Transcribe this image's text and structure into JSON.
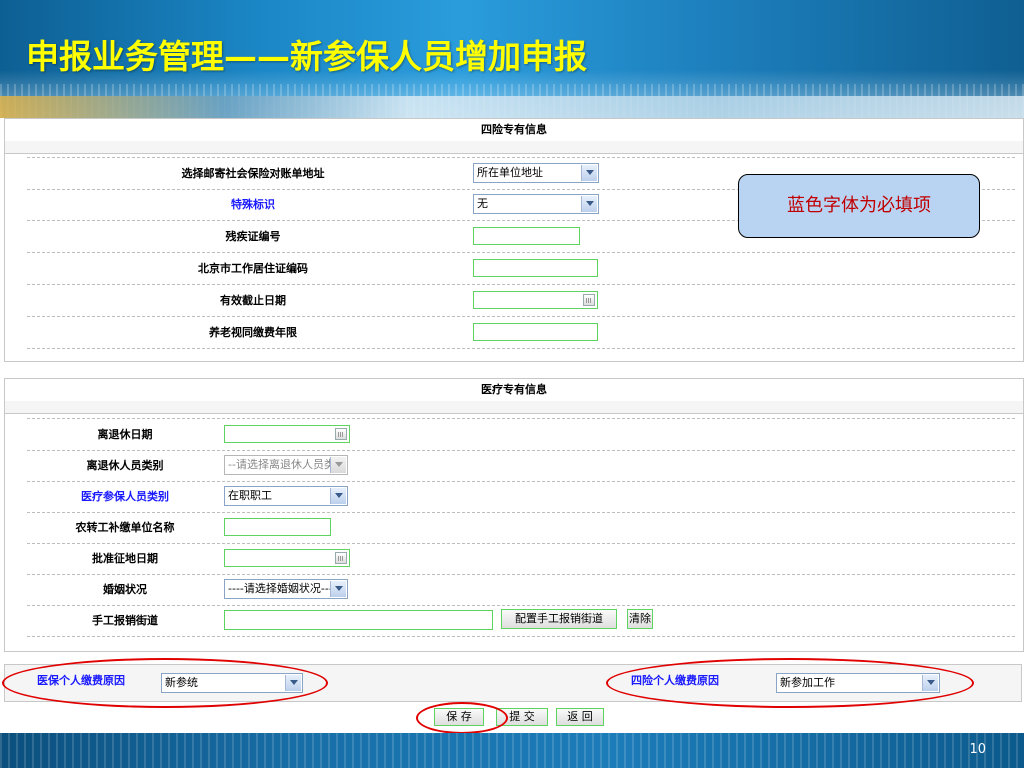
{
  "slide": {
    "title": "申报业务管理——新参保人员增加申报",
    "page_number": "10"
  },
  "note": "蓝色字体为必填项",
  "four_insurance": {
    "title": "四险专有信息",
    "rows": [
      {
        "label": "选择邮寄社会保险对账单地址",
        "value": "所在单位地址"
      },
      {
        "label": "特殊标识",
        "value": "无"
      },
      {
        "label": "残疾证编号",
        "value": ""
      },
      {
        "label": "北京市工作居住证编码",
        "value": ""
      },
      {
        "label": "有效截止日期",
        "value": ""
      },
      {
        "label": "养老视同缴费年限",
        "value": ""
      }
    ]
  },
  "medical": {
    "title": "医疗专有信息",
    "rows": [
      {
        "label": "离退休日期",
        "value": ""
      },
      {
        "label": "离退休人员类别",
        "value": "--请选择离退休人员类"
      },
      {
        "label": "医疗参保人员类别",
        "value": "在职职工"
      },
      {
        "label": "农转工补缴单位名称",
        "value": ""
      },
      {
        "label": "批准征地日期",
        "value": ""
      },
      {
        "label": "婚姻状况",
        "value": "----请选择婚姻状况----"
      },
      {
        "label": "手工报销街道",
        "value": ""
      }
    ],
    "config_button": "配置手工报销街道",
    "clear_button": "清除"
  },
  "reasons": {
    "medical_label": "医保个人缴费原因",
    "medical_value": "新参统",
    "four_label": "四险个人缴费原因",
    "four_value": "新参加工作"
  },
  "actions": {
    "save": "保 存",
    "submit": "提 交",
    "back": "返 回"
  }
}
